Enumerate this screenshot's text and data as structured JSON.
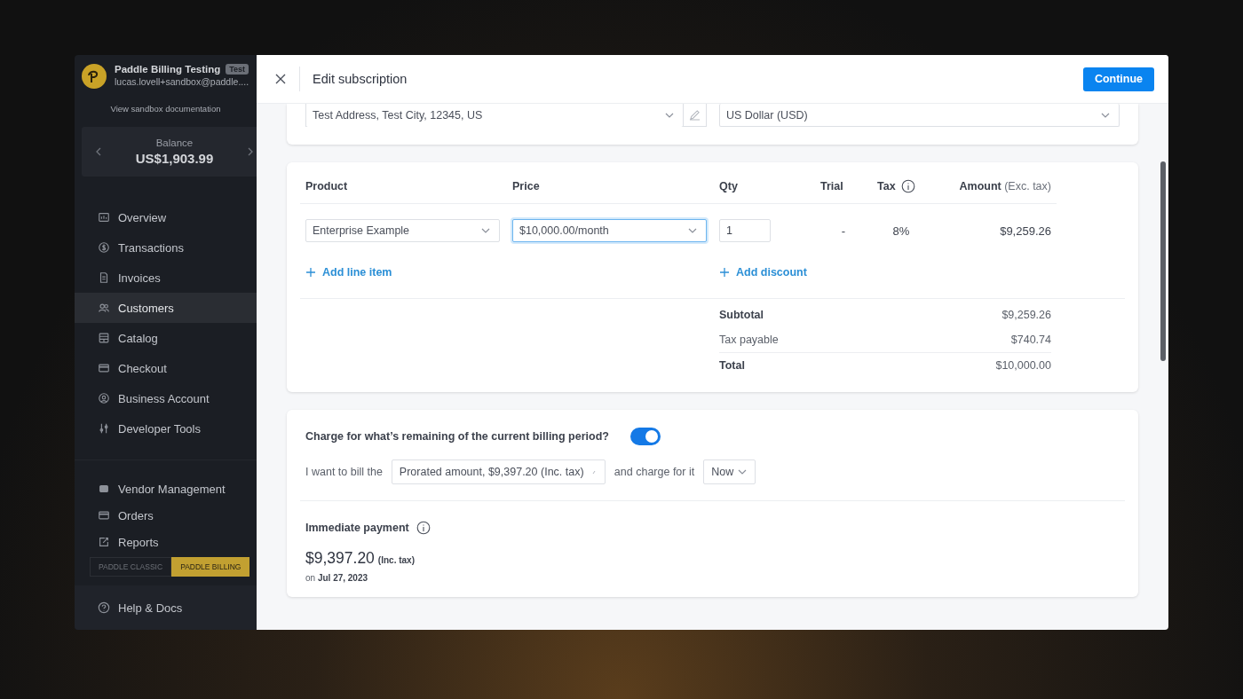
{
  "sidebar": {
    "account": {
      "name": "Paddle Billing Testing",
      "badge": "Test",
      "email": "lucas.lovell+sandbox@paddle....",
      "docs_link": "View sandbox documentation"
    },
    "balance": {
      "label": "Balance",
      "value": "US$1,903.99"
    },
    "nav": [
      {
        "label": "Overview",
        "selected": false
      },
      {
        "label": "Transactions",
        "selected": false
      },
      {
        "label": "Invoices",
        "selected": false
      },
      {
        "label": "Customers",
        "selected": true
      },
      {
        "label": "Catalog",
        "selected": false
      },
      {
        "label": "Checkout",
        "selected": false
      },
      {
        "label": "Business Account",
        "selected": false
      },
      {
        "label": "Developer Tools",
        "selected": false
      }
    ],
    "nav_secondary": [
      {
        "label": "Vendor Management",
        "selected": false
      },
      {
        "label": "Orders",
        "selected": false
      },
      {
        "label": "Reports",
        "selected": false
      }
    ],
    "mode_switch": [
      {
        "label": "PADDLE CLASSIC",
        "selected": false
      },
      {
        "label": "PADDLE BILLING",
        "selected": true
      }
    ],
    "help": "Help & Docs"
  },
  "dialog": {
    "title": "Edit subscription",
    "primary_button": "Continue",
    "address": {
      "value": "Test Address, Test City, 12345, US"
    },
    "currency": {
      "value": "US Dollar (USD)"
    },
    "items_table": {
      "columns": [
        {
          "label": "Product",
          "info": false
        },
        {
          "label": "Price",
          "info": false
        },
        {
          "label": "Qty",
          "info": false
        },
        {
          "label": "Trial",
          "info": false
        },
        {
          "label": "Tax",
          "info": true
        },
        {
          "label": "Amount",
          "note": "(Exc. tax)",
          "info": false
        }
      ],
      "rows": [
        {
          "product": "Enterprise Example",
          "price": "$10,000.00/month",
          "price_focused": true,
          "qty": "1",
          "trial": "-",
          "tax": "8%",
          "amount": "$9,259.26"
        }
      ],
      "add_line_item": "Add line item",
      "add_discount": "Add discount",
      "summary": [
        {
          "label": "Subtotal",
          "value": "$9,259.26",
          "emphasis": true
        },
        {
          "label": "Tax payable",
          "value": "$740.74",
          "emphasis": false
        },
        {
          "label": "Total",
          "value": "$10,000.00",
          "emphasis": true
        }
      ]
    },
    "proration": {
      "question": "Charge for what’s remaining of the current billing period?",
      "on": true,
      "bill_prefix": "I want to bill the",
      "bill_option": "Prorated amount, $9,397.20 (Inc. tax)",
      "charge_prefix": "and charge for it",
      "charge_option": "Now"
    },
    "immediate_payment": {
      "title": "Immediate payment",
      "amount": "$9,397.20",
      "amount_note": "(Inc. tax)",
      "date_prefix": "on",
      "date": "Jul 27, 2023"
    }
  }
}
